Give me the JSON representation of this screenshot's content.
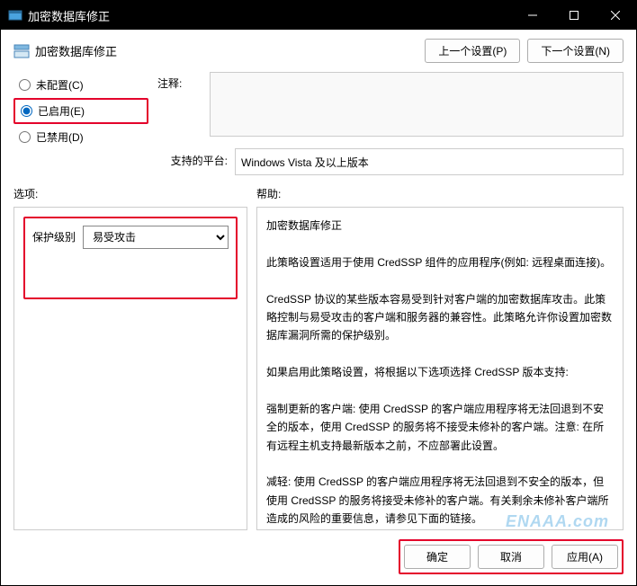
{
  "titlebar": {
    "title": "加密数据库修正"
  },
  "header": {
    "title": "加密数据库修正",
    "prev": "上一个设置(P)",
    "next": "下一个设置(N)"
  },
  "radios": {
    "not_configured": "未配置(C)",
    "enabled": "已启用(E)",
    "disabled": "已禁用(D)"
  },
  "labels": {
    "comment": "注释:",
    "platform": "支持的平台:",
    "options": "选项:",
    "help": "帮助:",
    "protection_level": "保护级别"
  },
  "fields": {
    "comment": "",
    "platform": "Windows Vista 及以上版本",
    "protection_level_value": "易受攻击"
  },
  "help_text": "加密数据库修正\n\n此策略设置适用于使用 CredSSP 组件的应用程序(例如: 远程桌面连接)。\n\nCredSSP 协议的某些版本容易受到针对客户端的加密数据库攻击。此策略控制与易受攻击的客户端和服务器的兼容性。此策略允许你设置加密数据库漏洞所需的保护级别。\n\n如果启用此策略设置，将根据以下选项选择 CredSSP 版本支持:\n\n强制更新的客户端: 使用 CredSSP 的客户端应用程序将无法回退到不安全的版本，使用 CredSSP 的服务将不接受未修补的客户端。注意: 在所有远程主机支持最新版本之前，不应部署此设置。\n\n减轻: 使用 CredSSP 的客户端应用程序将无法回退到不安全的版本，但使用 CredSSP 的服务将接受未修补的客户端。有关剩余未修补客户端所造成的风险的重要信息，请参见下面的链接。\n\n易受攻击: 如果使用 CredSSP 的客户端应用程序支持回退到不安全的版本，远程代码执行攻击将可能使远程服务器受到来自恶意客户端的威胁。",
  "footer": {
    "ok": "确定",
    "cancel": "取消",
    "apply": "应用(A)"
  },
  "watermark": "ENAAA.com"
}
